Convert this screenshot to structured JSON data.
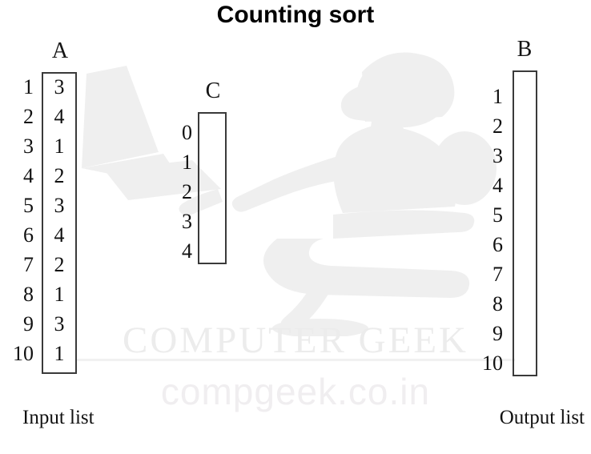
{
  "title": "Counting sort",
  "watermark": {
    "upper_text": "COMPUTER GEEK",
    "lower_text": "compgeek.co.in",
    "art_name": "person-reclining-at-computer-illustration",
    "color": "#ececec"
  },
  "arrays": {
    "input": {
      "label": "A",
      "caption": "Input list",
      "indices": [
        "1",
        "2",
        "3",
        "4",
        "5",
        "6",
        "7",
        "8",
        "9",
        "10"
      ],
      "values": [
        "3",
        "4",
        "1",
        "2",
        "3",
        "4",
        "2",
        "1",
        "3",
        "1"
      ]
    },
    "count": {
      "label": "C",
      "caption": "",
      "indices": [
        "0",
        "1",
        "2",
        "3",
        "4"
      ],
      "values": [
        "",
        "",
        "",
        "",
        ""
      ]
    },
    "output": {
      "label": "B",
      "caption": "Output list",
      "indices": [
        "1",
        "2",
        "3",
        "4",
        "5",
        "6",
        "7",
        "8",
        "9",
        "10"
      ],
      "values": [
        "",
        "",
        "",
        "",
        "",
        "",
        "",
        "",
        "",
        ""
      ]
    }
  },
  "colors": {
    "background": "#ffffff",
    "text": "#111111",
    "box_border": "#3a3a3a",
    "watermark": "#ececec"
  }
}
